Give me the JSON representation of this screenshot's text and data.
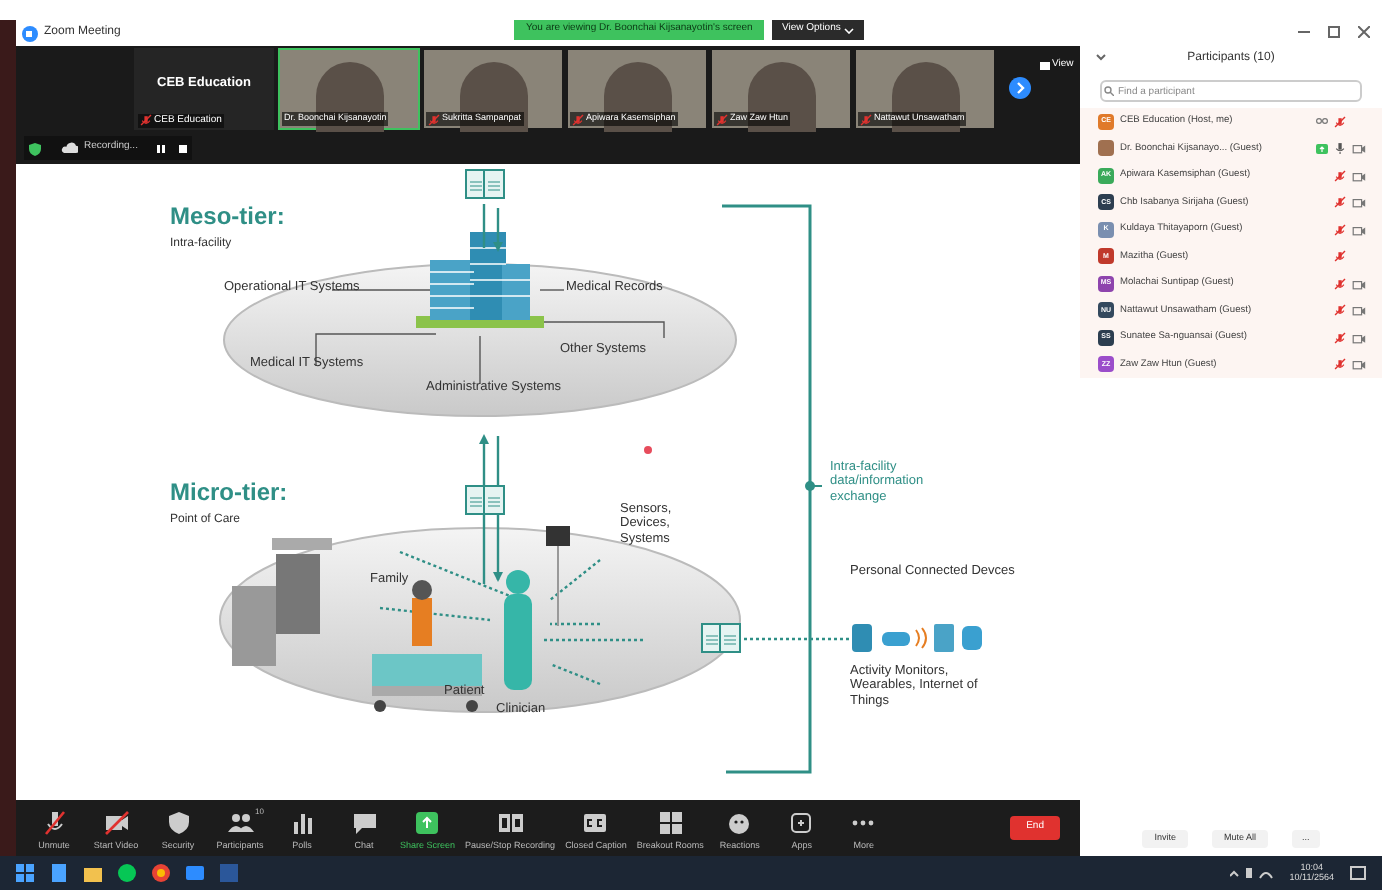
{
  "window": {
    "title": "Zoom Meeting"
  },
  "share_banner": {
    "text": "You are viewing Dr. Boonchai Kijsanayotin's screen",
    "options": "View Options"
  },
  "video_strip": {
    "host_tile": {
      "title": "CEB Education",
      "name": "CEB Education",
      "muted": true
    },
    "tiles": [
      {
        "name": "Dr. Boonchai Kijsanayotin",
        "muted": false,
        "selected": true
      },
      {
        "name": "Sukritta Sampanpat",
        "muted": true,
        "selected": false
      },
      {
        "name": "Apiwara Kasemsiphan",
        "muted": true,
        "selected": false
      },
      {
        "name": "Zaw Zaw Htun",
        "muted": true,
        "selected": false
      },
      {
        "name": "Nattawut Unsawatham",
        "muted": true,
        "selected": false
      }
    ],
    "view_label": "View"
  },
  "recording": {
    "label": "Recording..."
  },
  "slide": {
    "meso_title": "Meso-tier:",
    "meso_subtitle": "Intra-facility",
    "meso_labels": [
      "Operational IT Systems",
      "Medical Records",
      "Other Systems",
      "Medical IT Systems",
      "Administrative Systems"
    ],
    "micro_title": "Micro-tier:",
    "micro_subtitle": "Point of Care",
    "sensors": "Sensors, Devices, Systems",
    "family": "Family",
    "patient": "Patient",
    "clinician": "Clinician",
    "exchange": "Intra-facility data/information exchange",
    "personal": "Personal Connected Devces",
    "activity": "Activity Monitors, Wearables, Internet of Things"
  },
  "toolbar": {
    "buttons": [
      {
        "kind": "mic",
        "label": "Unmute"
      },
      {
        "kind": "video",
        "label": "Start Video"
      },
      {
        "kind": "shield",
        "label": "Security"
      },
      {
        "kind": "people",
        "label": "Participants",
        "count": "10"
      },
      {
        "kind": "poll",
        "label": "Polls"
      },
      {
        "kind": "chat",
        "label": "Chat"
      },
      {
        "kind": "share",
        "label": "Share Screen"
      },
      {
        "kind": "record",
        "label": "Pause/Stop Recording"
      },
      {
        "kind": "cc",
        "label": "Closed Caption"
      },
      {
        "kind": "rooms",
        "label": "Breakout Rooms"
      },
      {
        "kind": "reaction",
        "label": "Reactions"
      },
      {
        "kind": "apps",
        "label": "Apps"
      },
      {
        "kind": "more",
        "label": "More"
      }
    ],
    "end": "End"
  },
  "participants": {
    "title": "Participants (10)",
    "placeholder": "Find a participant",
    "items": [
      {
        "kind": "initials",
        "initials": "CE",
        "color": "#e07a2a",
        "name": "CEB Education (Host, me)",
        "speaker": true,
        "sharing": false,
        "muted": true,
        "camera": false
      },
      {
        "kind": "photo",
        "name": "Dr. Boonchai Kijsanayo... (Guest)",
        "speaker": false,
        "sharing": true,
        "muted": false,
        "camera": true
      },
      {
        "kind": "initials",
        "initials": "AK",
        "color": "#3aaa5a",
        "name": "Apiwara Kasemsiphan (Guest)",
        "speaker": false,
        "sharing": false,
        "muted": true,
        "camera": true
      },
      {
        "kind": "initials",
        "initials": "CS",
        "color": "#2d3e50",
        "name": "Chb Isabanya Sirijaha (Guest)",
        "speaker": false,
        "sharing": false,
        "muted": true,
        "camera": true
      },
      {
        "kind": "initials",
        "initials": "K",
        "color": "#7a8fb0",
        "name": "Kuldaya Thitayaporn (Guest)",
        "speaker": false,
        "sharing": false,
        "muted": true,
        "camera": true
      },
      {
        "kind": "initials",
        "initials": "M",
        "color": "#c0392b",
        "name": "Mazitha (Guest)",
        "speaker": false,
        "sharing": false,
        "muted": true,
        "camera": false
      },
      {
        "kind": "initials",
        "initials": "MS",
        "color": "#8e44ad",
        "name": "Molachai Suntipap (Guest)",
        "speaker": false,
        "sharing": false,
        "muted": true,
        "camera": true
      },
      {
        "kind": "initials",
        "initials": "NU",
        "color": "#34495e",
        "name": "Nattawut Unsawatham (Guest)",
        "speaker": false,
        "sharing": false,
        "muted": true,
        "camera": true
      },
      {
        "kind": "initials",
        "initials": "SS",
        "color": "#2c3e50",
        "name": "Sunatee Sa-nguansai (Guest)",
        "speaker": false,
        "sharing": false,
        "muted": true,
        "camera": true
      },
      {
        "kind": "initials",
        "initials": "ZZ",
        "color": "#9b4dca",
        "name": "Zaw Zaw Htun (Guest)",
        "speaker": false,
        "sharing": false,
        "muted": true,
        "camera": true
      }
    ],
    "invite": "Invite",
    "mute_all": "Mute All",
    "more": "..."
  },
  "taskbar": {
    "time": "10:04",
    "date": "10/11/2564"
  }
}
